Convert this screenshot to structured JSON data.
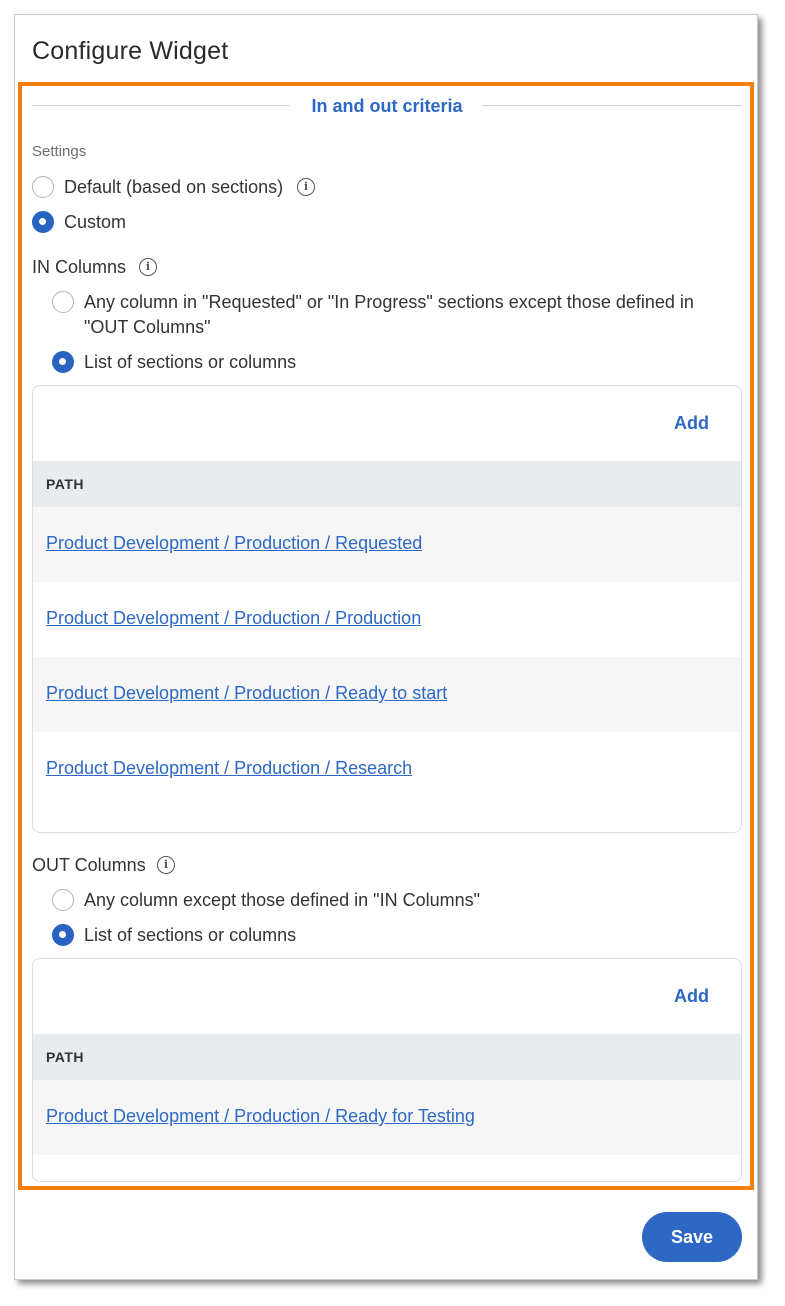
{
  "window": {
    "title": "Configure Widget"
  },
  "section": {
    "title": "In and out criteria"
  },
  "settings": {
    "label": "Settings",
    "options": [
      {
        "label": "Default (based on sections)",
        "selected": false
      },
      {
        "label": "Custom",
        "selected": true
      }
    ]
  },
  "in_columns": {
    "label": "IN Columns",
    "options": [
      {
        "label": "Any column in \"Requested\" or \"In Progress\" sections except those defined in \"OUT Columns\"",
        "selected": false
      },
      {
        "label": "List of sections or columns",
        "selected": true
      }
    ],
    "add_label": "Add",
    "header": "PATH",
    "rows": [
      "Product Development / Production / Requested",
      "Product Development / Production / Production",
      "Product Development / Production / Ready to start",
      "Product Development / Production / Research"
    ]
  },
  "out_columns": {
    "label": "OUT Columns",
    "options": [
      {
        "label": "Any column except those defined in \"IN Columns\"",
        "selected": false
      },
      {
        "label": "List of sections or columns",
        "selected": true
      }
    ],
    "add_label": "Add",
    "header": "PATH",
    "rows": [
      "Product Development / Production / Ready for Testing"
    ]
  },
  "footer": {
    "save_label": "Save"
  },
  "colors": {
    "accent": "#2d68c4",
    "highlight": "#f47e0f",
    "header_bg": "#e9ecef"
  }
}
